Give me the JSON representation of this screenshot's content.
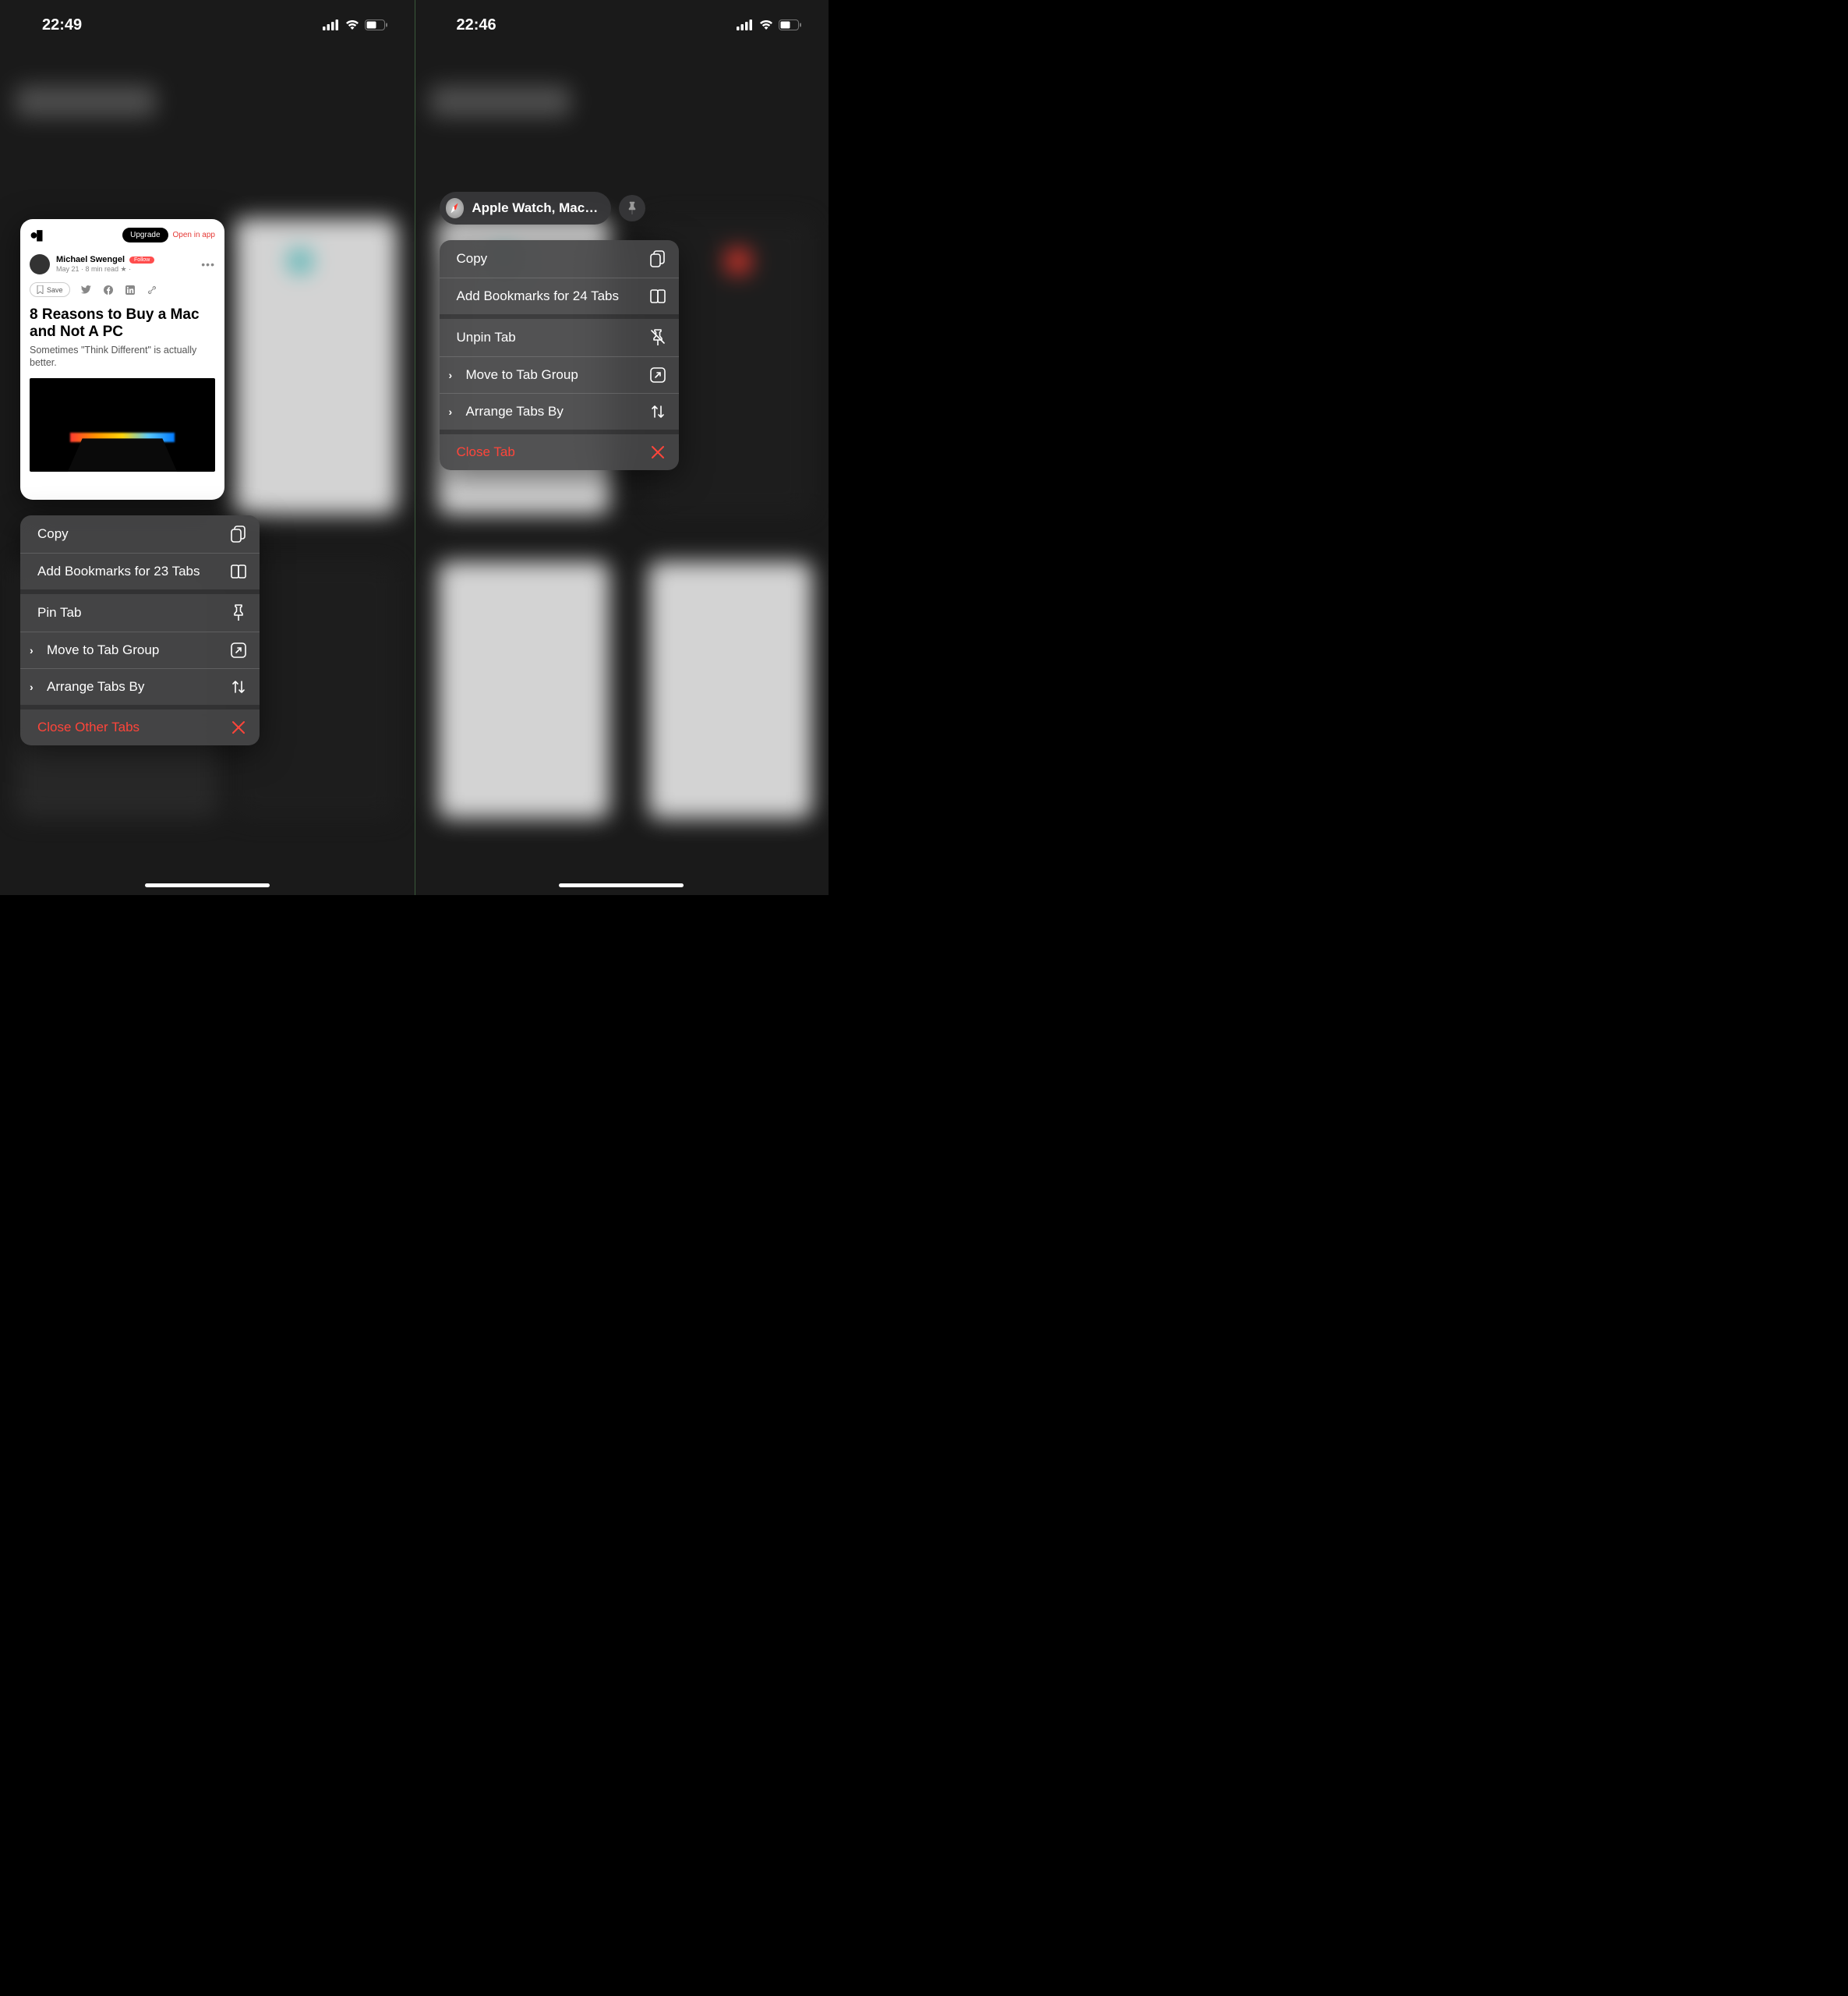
{
  "left": {
    "time": "22:49",
    "preview": {
      "upgrade": "Upgrade",
      "open_in_app": "Open in app",
      "author": "Michael Swengel",
      "follow": "Follow",
      "meta": "May 21  ·  8 min read  ★  ·",
      "save": "Save",
      "title": "8 Reasons to Buy a Mac and Not A PC",
      "subtitle": "Sometimes \"Think Different\" is actually better."
    },
    "menu": {
      "copy": "Copy",
      "bookmarks": "Add Bookmarks for 23 Tabs",
      "pin": "Pin Tab",
      "move": "Move to Tab Group",
      "arrange": "Arrange Tabs By",
      "close": "Close Other Tabs"
    }
  },
  "right": {
    "time": "22:46",
    "pinned_label": "Apple Watch, Mac &…",
    "menu": {
      "copy": "Copy",
      "bookmarks": "Add Bookmarks for 24 Tabs",
      "unpin": "Unpin Tab",
      "move": "Move to Tab Group",
      "arrange": "Arrange Tabs By",
      "close": "Close Tab"
    }
  }
}
